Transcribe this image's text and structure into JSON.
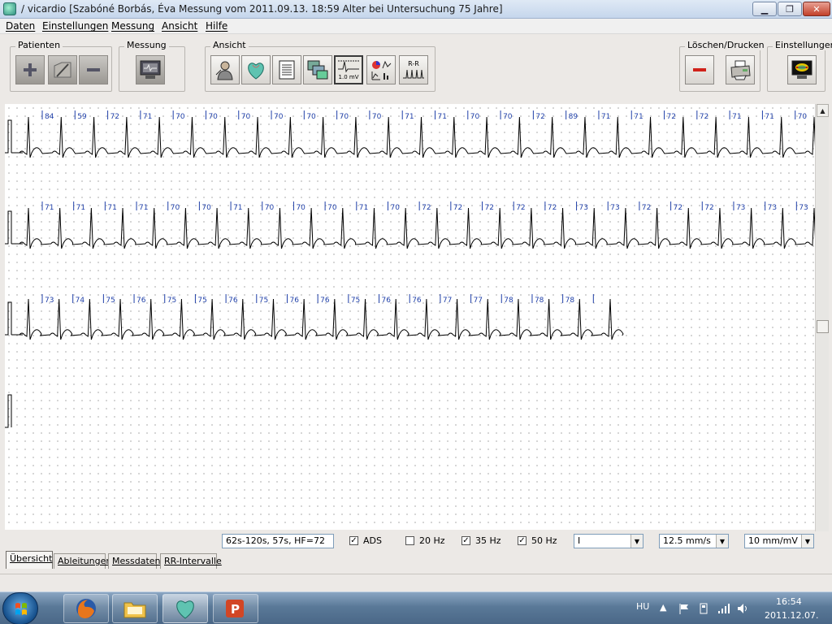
{
  "window": {
    "title": "/ vicardio [Szabóné Borbás, Éva Messung vom 2011.09.13. 18:59 Alter bei Untersuchung 75 Jahre]",
    "min_symbol": "▁",
    "max_symbol": "❐",
    "close_symbol": "✕"
  },
  "menu": {
    "daten": "Daten",
    "einstellungen": "Einstellungen",
    "messung": "Messung",
    "ansicht": "Ansicht",
    "hilfe": "Hilfe"
  },
  "toolbar": {
    "patienten_label": "Patienten",
    "messung_label": "Messung",
    "ansicht_label": "Ansicht",
    "loeschen_label": "Löschen/Drucken",
    "einstellungen_label": "Einstellungen",
    "scale_button_text": "1.0 mV",
    "rr_button_text": "R-R"
  },
  "ecg": {
    "trace_color": "#000000",
    "label_color": "#1f3fa8",
    "rows": [
      {
        "hr_labels": [
          "84",
          "59",
          "72",
          "71",
          "70",
          "70",
          "70",
          "70",
          "70",
          "70",
          "70",
          "71",
          "71",
          "70",
          "70",
          "72",
          "89",
          "71",
          "71",
          "72",
          "72",
          "71",
          "71",
          "70"
        ]
      },
      {
        "hr_labels": [
          "71",
          "71",
          "71",
          "71",
          "70",
          "70",
          "71",
          "70",
          "70",
          "70",
          "71",
          "70",
          "72",
          "72",
          "72",
          "72",
          "72",
          "73",
          "73",
          "72",
          "72",
          "72",
          "73",
          "73",
          "73"
        ]
      },
      {
        "hr_labels": [
          "73",
          "74",
          "75",
          "76",
          "75",
          "75",
          "76",
          "75",
          "76",
          "76",
          "75",
          "76",
          "76",
          "77",
          "77",
          "78",
          "78",
          "78",
          ""
        ]
      },
      {
        "hr_labels": []
      }
    ]
  },
  "controls": {
    "info_text": "62s-120s, 57s, HF=72",
    "ads_label": "ADS",
    "ads_checked": true,
    "hz20_label": "20 Hz",
    "hz20_checked": false,
    "hz35_label": "35 Hz",
    "hz35_checked": true,
    "hz50_label": "50 Hz",
    "hz50_checked": true,
    "lead_value": "I",
    "speed_value": "12.5 mm/s",
    "gain_value": "10 mm/mV"
  },
  "tabs": [
    "Übersicht",
    "Ableitungen",
    "Messdaten",
    "RR-Intervalle"
  ],
  "active_tab": "Übersicht",
  "taskbar": {
    "language": "HU",
    "time": "16:54",
    "date": "2011.12.07."
  }
}
